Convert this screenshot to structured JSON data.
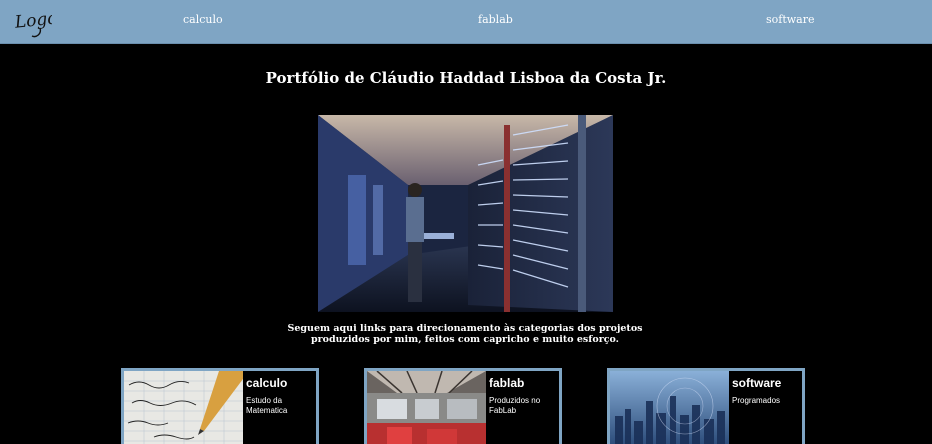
{
  "navbar": {
    "logo_text": "Logo",
    "links": [
      "calculo",
      "fablab",
      "software"
    ]
  },
  "main": {
    "title": "Portfólio de Cláudio Haddad Lisboa da Costa Jr.",
    "description": "Seguem aqui links para direcionamento às categorias dos projetos produzidos por mim, feitos com capricho e muito esforço."
  },
  "cards": [
    {
      "title": "calculo",
      "subtitle": "Estudo da Matematica"
    },
    {
      "title": "fablab",
      "subtitle": "Produzidos no FabLab"
    },
    {
      "title": "software",
      "subtitle": "Programados"
    }
  ],
  "colors": {
    "navbar": "#7fa5c4",
    "background": "#000000",
    "card_border": "#7fa5c4"
  }
}
